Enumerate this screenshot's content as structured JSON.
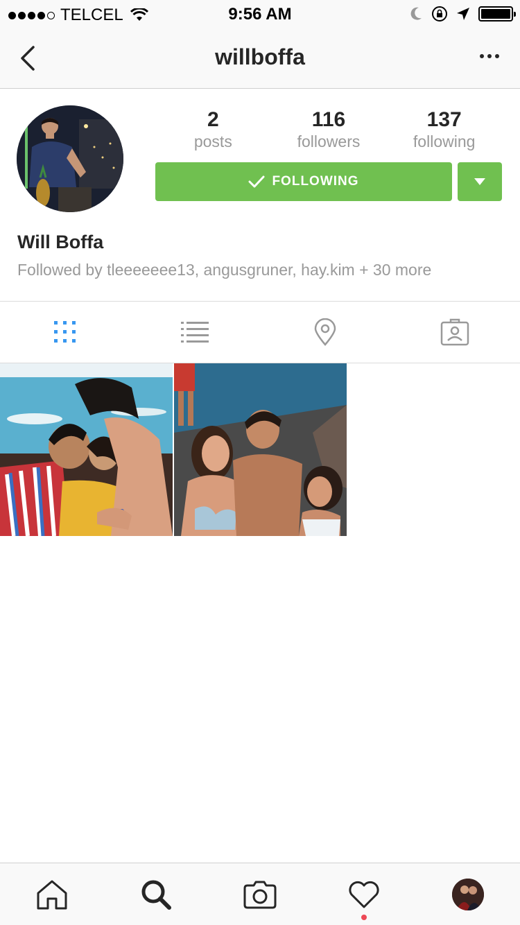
{
  "status_bar": {
    "carrier": "TELCEL",
    "time": "9:56 AM",
    "signal_bars_filled": 4,
    "signal_bars_total": 5
  },
  "nav": {
    "title": "willboffa",
    "back_icon": "chevron-left-icon",
    "more_icon": "ellipsis-icon"
  },
  "profile": {
    "stats": [
      {
        "value": "2",
        "label": "posts"
      },
      {
        "value": "116",
        "label": "followers"
      },
      {
        "value": "137",
        "label": "following"
      }
    ],
    "following_button": "FOLLOWING",
    "name": "Will Boffa",
    "followed_by": "Followed by tleeeeeee13, angusgruner, hay.kim + 30 more"
  },
  "tabs": [
    {
      "icon": "grid-icon",
      "active": true
    },
    {
      "icon": "list-icon",
      "active": false
    },
    {
      "icon": "location-pin-icon",
      "active": false
    },
    {
      "icon": "tagged-photos-icon",
      "active": false
    }
  ],
  "posts_count_shown": 2,
  "bottom_bar": [
    {
      "icon": "home-icon"
    },
    {
      "icon": "search-icon",
      "active": true
    },
    {
      "icon": "camera-icon"
    },
    {
      "icon": "heart-icon",
      "has_notification": true
    },
    {
      "icon": "profile-avatar"
    }
  ],
  "colors": {
    "accent_green": "#70c050",
    "active_tab_blue": "#3897f0",
    "muted_text": "#999999",
    "notification_red": "#ed4956"
  }
}
